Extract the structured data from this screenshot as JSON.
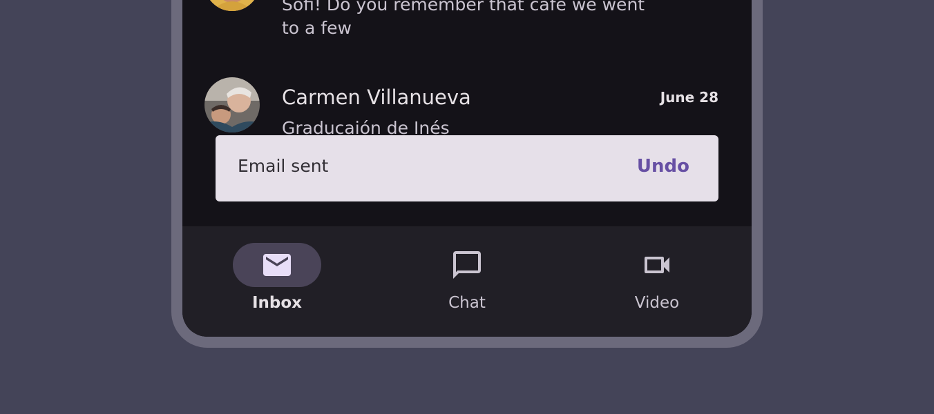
{
  "emails": [
    {
      "sender": "",
      "snippet_lines": [
        "Sofi! Do you remember that cafe we went",
        "to a few"
      ],
      "avatar_icon": "person-photo-avatar"
    },
    {
      "sender": "Carmen Villanueva",
      "date": "June 28",
      "snippet_lines": [
        "Graducaión de Inés"
      ],
      "avatar_icon": "person-photo-avatar"
    }
  ],
  "snackbar": {
    "message": "Email sent",
    "action": "Undo"
  },
  "nav": {
    "items": [
      {
        "label": "Inbox",
        "icon": "mail-icon",
        "active": true
      },
      {
        "label": "Chat",
        "icon": "chat-icon",
        "active": false
      },
      {
        "label": "Video",
        "icon": "videocam-icon",
        "active": false
      }
    ]
  },
  "colors": {
    "page_background": "#444458",
    "device_frame": "#6c6a7c",
    "screen_background": "#141218",
    "navbar_background": "#211f26",
    "active_pill": "#4a4458",
    "snackbar_background": "#e6e0e9",
    "snackbar_action": "#6750a4"
  }
}
